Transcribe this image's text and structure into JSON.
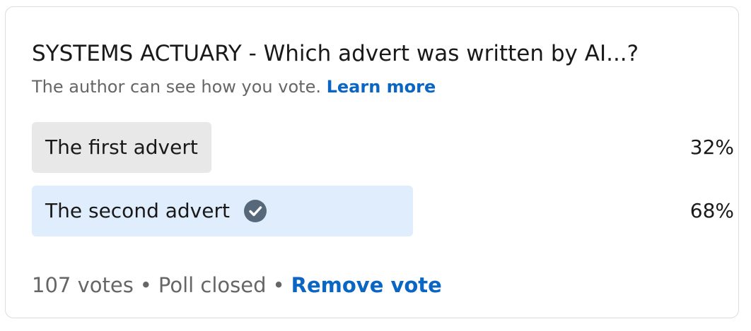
{
  "poll": {
    "title": "SYSTEMS ACTUARY - Which advert was written by AI...?",
    "subtitle": "The author can see how you vote.",
    "learn_more": "Learn more",
    "options": [
      {
        "label": "The first advert",
        "percent_label": "32%",
        "percent": 32,
        "selected": false,
        "bar_color": "#e8e8e8"
      },
      {
        "label": "The second advert",
        "percent_label": "68%",
        "percent": 68,
        "selected": true,
        "bar_color": "#dfedfc"
      }
    ],
    "footer": {
      "votes": "107 votes",
      "separator": "•",
      "status": "Poll closed",
      "remove_vote": "Remove vote"
    },
    "colors": {
      "accent": "#0a66c2",
      "check_icon": "#56687a"
    }
  }
}
